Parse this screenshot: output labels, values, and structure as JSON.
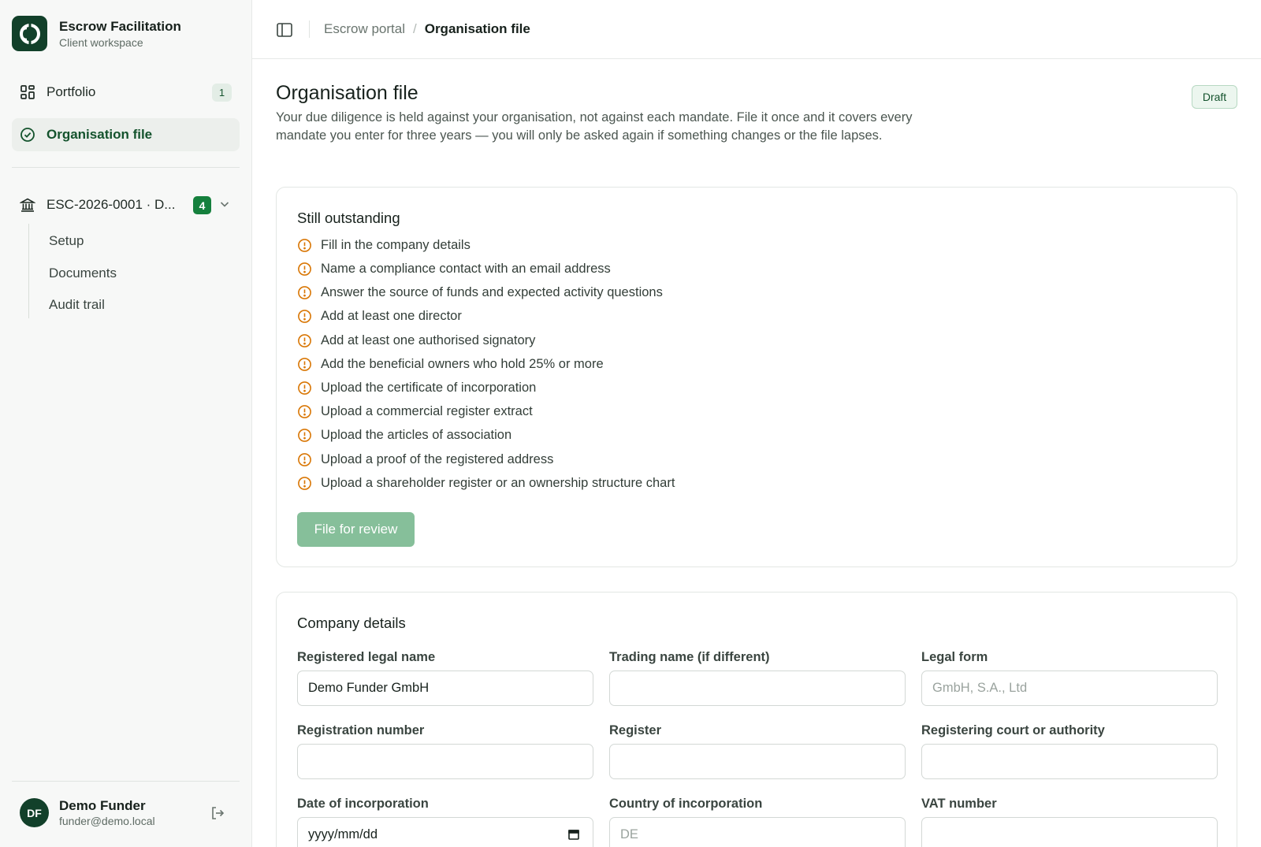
{
  "brand": {
    "title": "Escrow Facilitation",
    "subtitle": "Client workspace"
  },
  "nav": {
    "portfolio": {
      "label": "Portfolio",
      "count": "1"
    },
    "organisation": {
      "label": "Organisation file"
    }
  },
  "mandate": {
    "label": "ESC-2026-0001 · D...",
    "count": "4",
    "sub_items": [
      {
        "label": "Setup"
      },
      {
        "label": "Documents"
      },
      {
        "label": "Audit trail"
      }
    ]
  },
  "user": {
    "initials": "DF",
    "name": "Demo Funder",
    "email": "funder@demo.local"
  },
  "breadcrumb": {
    "parent": "Escrow portal",
    "separator": "/",
    "current": "Organisation file"
  },
  "page": {
    "title": "Organisation file",
    "description": "Your due diligence is held against your organisation, not against each mandate. File it once and it covers every mandate you enter for three years — you will only be asked again if something changes or the file lapses.",
    "status": "Draft"
  },
  "outstanding": {
    "title": "Still outstanding",
    "items": [
      "Fill in the company details",
      "Name a compliance contact with an email address",
      "Answer the source of funds and expected activity questions",
      "Add at least one director",
      "Add at least one authorised signatory",
      "Add the beneficial owners who hold 25% or more",
      "Upload the certificate of incorporation",
      "Upload a commercial register extract",
      "Upload the articles of association",
      "Upload a proof of the registered address",
      "Upload a shareholder register or an ownership structure chart"
    ],
    "submit_label": "File for review"
  },
  "company": {
    "title": "Company details",
    "fields": [
      {
        "label": "Registered legal name",
        "value": "Demo Funder GmbH",
        "placeholder": ""
      },
      {
        "label": "Trading name (if different)",
        "value": "",
        "placeholder": ""
      },
      {
        "label": "Legal form",
        "value": "",
        "placeholder": "GmbH, S.A., Ltd"
      },
      {
        "label": "Registration number",
        "value": "",
        "placeholder": ""
      },
      {
        "label": "Register",
        "value": "",
        "placeholder": ""
      },
      {
        "label": "Registering court or authority",
        "value": "",
        "placeholder": ""
      },
      {
        "label": "Date of incorporation",
        "value": "",
        "placeholder": "yyyy/mm/dd"
      },
      {
        "label": "Country of incorporation",
        "value": "",
        "placeholder": "DE"
      },
      {
        "label": "VAT number",
        "value": "",
        "placeholder": ""
      }
    ]
  },
  "colors": {
    "accent": "#14532d",
    "warning": "#d97706",
    "button_disabled": "#86bf9a"
  }
}
